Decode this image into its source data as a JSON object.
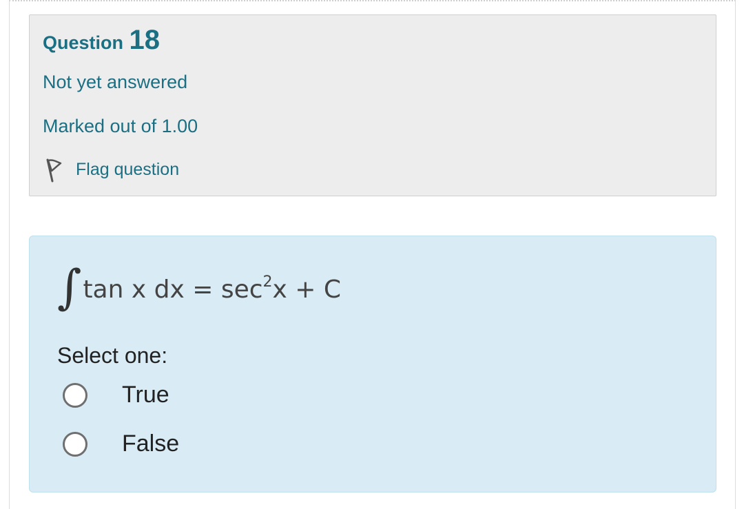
{
  "question_info": {
    "label": "Question",
    "number": "18",
    "state": "Not yet answered",
    "grade": "Marked out of 1.00",
    "flag_label": "Flag question"
  },
  "question": {
    "integral_sign": "∫",
    "expr_left": "tan x dx = sec",
    "expr_exponent": "2",
    "expr_right": "x + C",
    "prompt": "Select one:",
    "options": [
      {
        "label": "True",
        "selected": false
      },
      {
        "label": "False",
        "selected": false
      }
    ]
  },
  "colors": {
    "accent": "#1b6f83",
    "info_bg": "#ededed",
    "content_bg": "#d9ecf5"
  }
}
